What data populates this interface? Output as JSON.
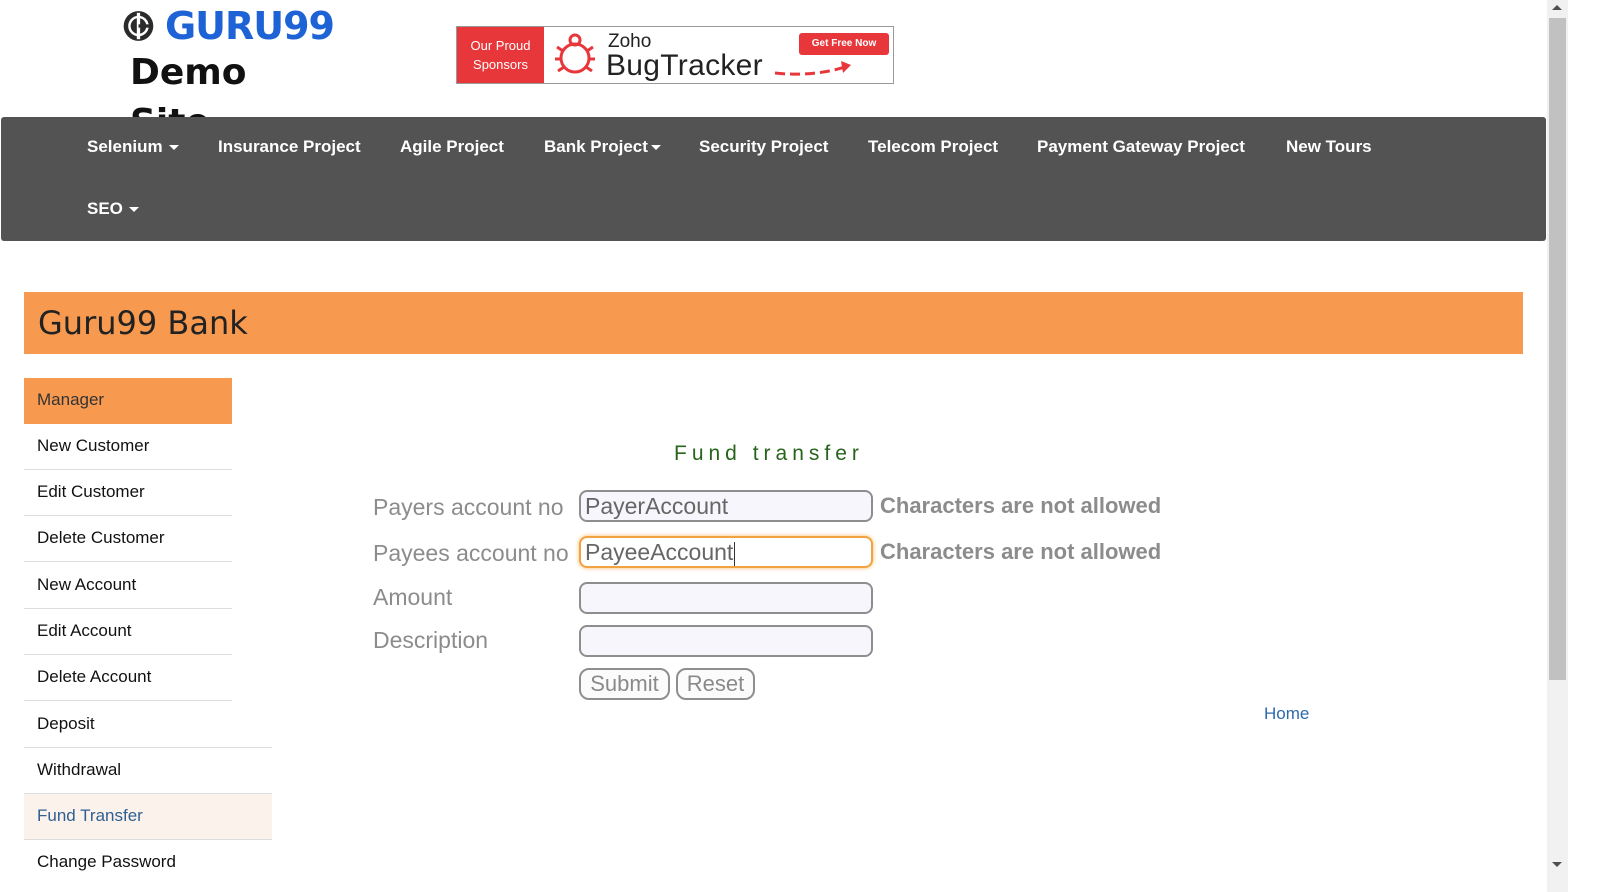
{
  "header": {
    "logo_text": "GURU99",
    "logo_subtitle": "Demo Site",
    "banner": {
      "left_line1": "Our Proud",
      "left_line2": "Sponsors",
      "brand": "Zoho",
      "product": "BugTracker",
      "cta": "Get Free Now"
    }
  },
  "nav": {
    "selenium": "Selenium",
    "insurance": "Insurance Project",
    "agile": "Agile Project",
    "bank": "Bank Project",
    "security": "Security Project",
    "telecom": "Telecom Project",
    "payment": "Payment Gateway Project",
    "new_tours": "New Tours",
    "seo": "SEO"
  },
  "bank_title": "Guru99 Bank",
  "sidebar": {
    "manager": "Manager",
    "items": [
      "New Customer",
      "Edit Customer",
      "Delete Customer",
      "New Account",
      "Edit Account",
      "Delete Account",
      "Deposit",
      "Withdrawal",
      "Fund Transfer",
      "Change Password"
    ],
    "active_item": "Fund Transfer"
  },
  "form": {
    "title": "Fund transfer",
    "payer_label": "Payers account no",
    "payer_value": "PayerAccount",
    "payee_label": "Payees account no",
    "payee_value": "PayeeAccount",
    "amount_label": "Amount",
    "amount_value": "",
    "description_label": "Description",
    "description_value": "",
    "payer_error": "Characters are not allowed",
    "payee_error": "Characters are not allowed",
    "submit_label": "Submit",
    "reset_label": "Reset"
  },
  "home_link": "Home",
  "colors": {
    "nav_bg": "#535353",
    "accent_orange": "#f79a50",
    "logo_blue": "#1e63d6",
    "form_title_green": "#27641c",
    "link_blue": "#2f6aac"
  }
}
